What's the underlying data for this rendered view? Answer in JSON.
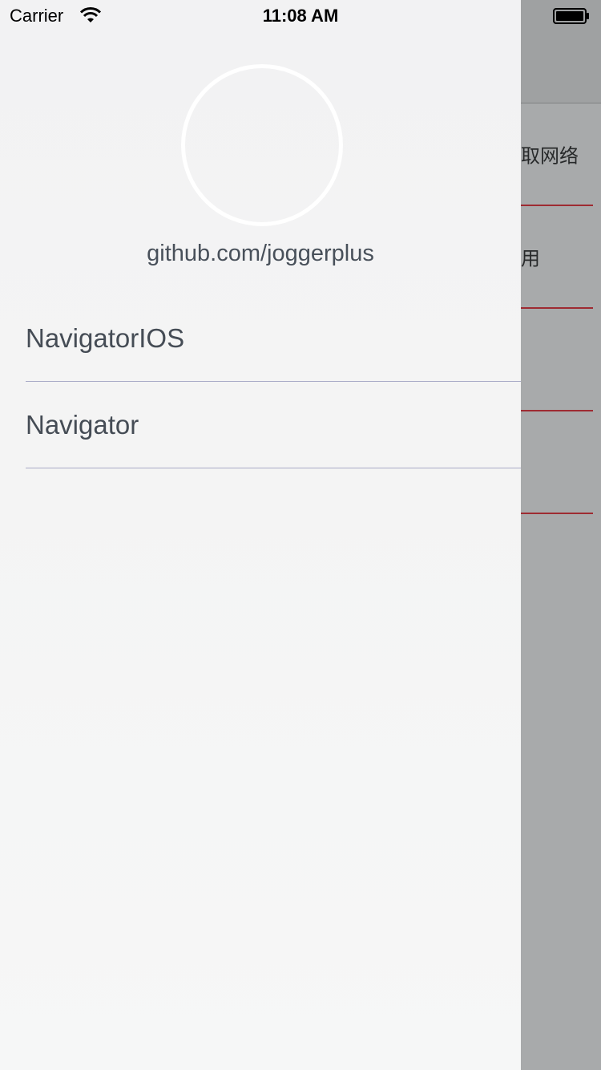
{
  "status_bar": {
    "carrier": "Carrier",
    "time": "11:08 AM",
    "icons": [
      "wifi-icon",
      "battery-icon"
    ]
  },
  "drawer": {
    "username": "github.com/joggerplus",
    "menu": [
      {
        "label": "NavigatorIOS"
      },
      {
        "label": "Navigator"
      }
    ]
  },
  "main": {
    "rows": [
      {
        "label": "取网络"
      },
      {
        "label": "用"
      },
      {
        "label": ""
      },
      {
        "label": ""
      }
    ],
    "divider_color": "#c8141e"
  }
}
